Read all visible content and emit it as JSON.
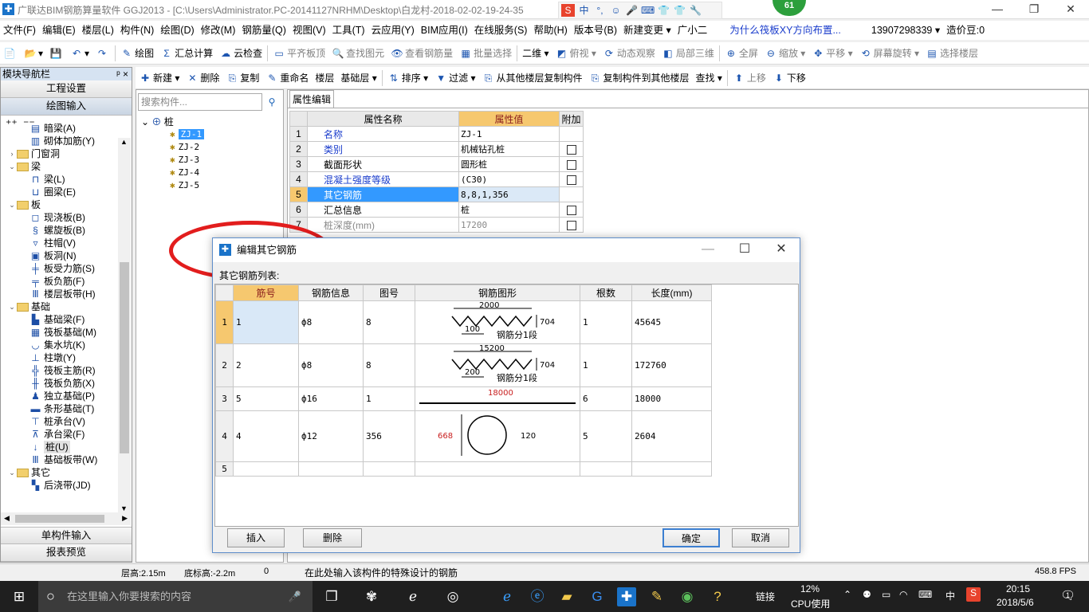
{
  "window": {
    "title": "广联达BIM钢筋算量软件 GGJ2013 - [C:\\Users\\Administrator.PC-20141127NRHM\\Desktop\\白龙村-2018-02-02-19-24-35",
    "min": "—",
    "max": "❐",
    "close": "✕"
  },
  "ime": {
    "items": [
      "S",
      "中",
      "°,",
      "☺",
      "🎤",
      "⌨",
      "👕",
      "👕",
      "🔧"
    ]
  },
  "badge": "61",
  "menu": [
    "文件(F)",
    "编辑(E)",
    "楼层(L)",
    "构件(N)",
    "绘图(D)",
    "修改(M)",
    "钢筋量(Q)",
    "视图(V)",
    "工具(T)",
    "云应用(Y)",
    "BIM应用(I)",
    "在线服务(S)",
    "帮助(H)",
    "版本号(B)",
    "新建变更 ▾",
    "广小二",
    "为什么筏板XY方向布置...",
    "13907298339 ▾",
    "造价豆:0"
  ],
  "toolbar1": [
    {
      "icon": "📄",
      "label": ""
    },
    {
      "icon": "📂",
      "label": "▾"
    },
    {
      "icon": "💾",
      "label": ""
    },
    {
      "icon": "↶",
      "label": "▾"
    },
    {
      "icon": "↷",
      "label": ""
    },
    {
      "icon": "✎",
      "label": "绘图"
    },
    {
      "icon": "Σ",
      "label": "汇总计算"
    },
    {
      "icon": "☁",
      "label": "云检查"
    },
    {
      "icon": "▭",
      "label": "平齐板顶"
    },
    {
      "icon": "🔍",
      "label": "查找图元"
    },
    {
      "icon": "👁",
      "label": "查看钢筋量"
    },
    {
      "icon": "▦",
      "label": "批量选择"
    },
    {
      "icon": "",
      "label": "二维 ▾"
    },
    {
      "icon": "◩",
      "label": "俯视 ▾"
    },
    {
      "icon": "⟳",
      "label": "动态观察"
    },
    {
      "icon": "◧",
      "label": "局部三维"
    },
    {
      "icon": "⊕",
      "label": "全屏"
    },
    {
      "icon": "⊖",
      "label": "缩放 ▾"
    },
    {
      "icon": "✥",
      "label": "平移 ▾"
    },
    {
      "icon": "⟲",
      "label": "屏幕旋转 ▾"
    },
    {
      "icon": "▤",
      "label": "选择楼层"
    }
  ],
  "toolbar2": [
    {
      "icon": "✚",
      "label": "新建 ▾"
    },
    {
      "icon": "✕",
      "label": "删除"
    },
    {
      "icon": "⎘",
      "label": "复制"
    },
    {
      "icon": "✎",
      "label": "重命名"
    },
    {
      "icon": "",
      "label": "楼层"
    },
    {
      "icon": "",
      "label": "基础层 ▾"
    },
    {
      "icon": "⇅",
      "label": "排序 ▾"
    },
    {
      "icon": "▼",
      "label": "过滤 ▾"
    },
    {
      "icon": "⎘",
      "label": "从其他楼层复制构件"
    },
    {
      "icon": "⎘",
      "label": "复制构件到其他楼层"
    },
    {
      "icon": "",
      "label": "查找 ▾"
    },
    {
      "icon": "⬆",
      "label": "上移"
    },
    {
      "icon": "⬇",
      "label": "下移"
    }
  ],
  "nav": {
    "header": "模块导航栏",
    "pin": "ᵖ ×",
    "top_buttons": [
      "工程设置",
      "绘图输入"
    ],
    "tree": [
      {
        "level": 2,
        "type": "item",
        "icon": "▤",
        "label": "暗梁(A)"
      },
      {
        "level": 2,
        "type": "item",
        "icon": "▥",
        "label": "砌体加筋(Y)"
      },
      {
        "level": 0,
        "type": "folder",
        "exp": "›",
        "label": "门窗洞"
      },
      {
        "level": 0,
        "type": "folder",
        "exp": "⌄",
        "label": "梁"
      },
      {
        "level": 2,
        "type": "item",
        "icon": "⊓",
        "label": "梁(L)"
      },
      {
        "level": 2,
        "type": "item",
        "icon": "⊔",
        "label": "圈梁(E)"
      },
      {
        "level": 0,
        "type": "folder",
        "exp": "⌄",
        "label": "板"
      },
      {
        "level": 2,
        "type": "item",
        "icon": "◻",
        "label": "现浇板(B)"
      },
      {
        "level": 2,
        "type": "item",
        "icon": "§",
        "label": "螺旋板(B)"
      },
      {
        "level": 2,
        "type": "item",
        "icon": "▿",
        "label": "柱帽(V)"
      },
      {
        "level": 2,
        "type": "item",
        "icon": "▣",
        "label": "板洞(N)"
      },
      {
        "level": 2,
        "type": "item",
        "icon": "╪",
        "label": "板受力筋(S)"
      },
      {
        "level": 2,
        "type": "item",
        "icon": "╤",
        "label": "板负筋(F)"
      },
      {
        "level": 2,
        "type": "item",
        "icon": "Ⅲ",
        "label": "楼层板带(H)"
      },
      {
        "level": 0,
        "type": "folder",
        "exp": "⌄",
        "label": "基础"
      },
      {
        "level": 2,
        "type": "item",
        "icon": "▙",
        "label": "基础梁(F)"
      },
      {
        "level": 2,
        "type": "item",
        "icon": "▦",
        "label": "筏板基础(M)"
      },
      {
        "level": 2,
        "type": "item",
        "icon": "◡",
        "label": "集水坑(K)"
      },
      {
        "level": 2,
        "type": "item",
        "icon": "⊥",
        "label": "柱墩(Y)"
      },
      {
        "level": 2,
        "type": "item",
        "icon": "╬",
        "label": "筏板主筋(R)"
      },
      {
        "level": 2,
        "type": "item",
        "icon": "╫",
        "label": "筏板负筋(X)"
      },
      {
        "level": 2,
        "type": "item",
        "icon": "♟",
        "label": "独立基础(P)"
      },
      {
        "level": 2,
        "type": "item",
        "icon": "▬",
        "label": "条形基础(T)"
      },
      {
        "level": 2,
        "type": "item",
        "icon": "⊤",
        "label": "桩承台(V)"
      },
      {
        "level": 2,
        "type": "item",
        "icon": "⊼",
        "label": "承台梁(F)"
      },
      {
        "level": 2,
        "type": "item",
        "icon": "↓",
        "label": "桩(U)",
        "selected": true
      },
      {
        "level": 2,
        "type": "item",
        "icon": "Ⅲ",
        "label": "基础板带(W)"
      },
      {
        "level": 0,
        "type": "folder",
        "exp": "⌄",
        "label": "其它"
      },
      {
        "level": 2,
        "type": "item",
        "icon": "▚",
        "label": "后浇带(JD)"
      }
    ],
    "bottom_buttons": [
      "单构件输入",
      "报表预览"
    ]
  },
  "components": {
    "search_placeholder": "搜索构件...",
    "root": "桩",
    "items": [
      "ZJ-1",
      "ZJ-2",
      "ZJ-3",
      "ZJ-4",
      "ZJ-5"
    ]
  },
  "props": {
    "tab": "属性编辑",
    "headers": [
      "属性名称",
      "属性值",
      "附加"
    ],
    "rows": [
      {
        "n": "1",
        "name": "名称",
        "value": "ZJ-1",
        "cb": false,
        "style": "blue"
      },
      {
        "n": "2",
        "name": "类别",
        "value": "机械钻孔桩",
        "cb": true,
        "style": "blue"
      },
      {
        "n": "3",
        "name": "截面形状",
        "value": "圆形桩",
        "cb": true,
        "style": ""
      },
      {
        "n": "4",
        "name": "混凝土强度等级",
        "value": "(C30)",
        "cb": true,
        "style": "blue"
      },
      {
        "n": "5",
        "name": "其它钢筋",
        "value": "8,8,1,356",
        "cb": false,
        "style": "sel"
      },
      {
        "n": "6",
        "name": "汇总信息",
        "value": "桩",
        "cb": true,
        "style": ""
      },
      {
        "n": "7",
        "name": "桩深度(mm)",
        "value": "17200",
        "cb": true,
        "style": "gray"
      }
    ]
  },
  "dialog": {
    "title": "编辑其它钢筋",
    "list_label": "其它钢筋列表:",
    "headers": [
      "筋号",
      "钢筋信息",
      "图号",
      "钢筋图形",
      "根数",
      "长度(mm)"
    ],
    "rows": [
      {
        "n": "1",
        "no": "1",
        "info": "ф8",
        "fig": "8",
        "count": "1",
        "len": "45645",
        "shape": "spiral",
        "top": "2000",
        "pitch": "100",
        "h": "704",
        "note": "钢筋分1段"
      },
      {
        "n": "2",
        "no": "2",
        "info": "ф8",
        "fig": "8",
        "count": "1",
        "len": "172760",
        "shape": "spiral",
        "top": "15200",
        "pitch": "200",
        "h": "704",
        "note": "钢筋分1段"
      },
      {
        "n": "3",
        "no": "5",
        "info": "ф16",
        "fig": "1",
        "count": "6",
        "len": "18000",
        "shape": "line",
        "top": "18000"
      },
      {
        "n": "4",
        "no": "4",
        "info": "ф12",
        "fig": "356",
        "count": "5",
        "len": "2604",
        "shape": "circle",
        "left": "668",
        "right": "120"
      },
      {
        "n": "5",
        "no": "",
        "info": "",
        "fig": "",
        "count": "",
        "len": "",
        "shape": ""
      }
    ],
    "buttons": {
      "insert": "插入",
      "delete": "删除",
      "ok": "确定",
      "cancel": "取消"
    },
    "minimize": "—",
    "maximize": "☐",
    "close": "✕"
  },
  "status": {
    "floor_height": "层高:2.15m",
    "bottom_height": "底标高:-2.2m",
    "zero": "0",
    "hint": "在此处输入该构件的特殊设计的钢筋",
    "fps": "458.8 FPS"
  },
  "taskbar": {
    "search_placeholder": "在这里输入你要搜索的内容",
    "cpu": "12%",
    "cpu_label": "CPU使用",
    "link": "链接",
    "ime": "中",
    "time": "20:15",
    "date": "2018/5/6",
    "notif": "1"
  }
}
